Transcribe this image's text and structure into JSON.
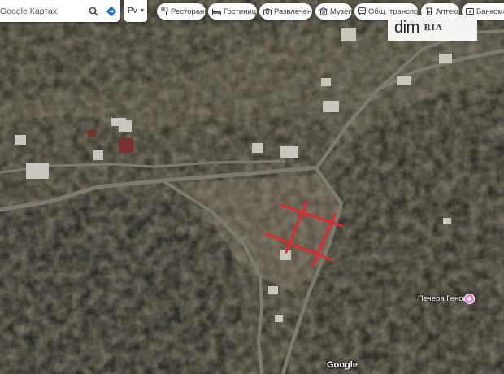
{
  "search": {
    "placeholder": "Google Картах"
  },
  "layer_select": {
    "label": "Рv"
  },
  "chips": [
    {
      "label": "Рестораны",
      "icon": "restaurant-icon"
    },
    {
      "label": "Гостиницы",
      "icon": "hotel-icon"
    },
    {
      "label": "Развлечения",
      "icon": "camera-icon"
    },
    {
      "label": "Музеи",
      "icon": "museum-icon"
    },
    {
      "label": "Общ. транспорт",
      "icon": "transit-icon"
    },
    {
      "label": "Аптеки",
      "icon": "pharmacy-icon"
    },
    {
      "label": "Банкоматы",
      "icon": "atm-icon"
    }
  ],
  "watermark": {
    "brand": "dim",
    "brand_suffix": "RIA"
  },
  "poi": {
    "label": "Печера Геноват",
    "icon": "poi-pin-icon",
    "color": "#e37bd0"
  },
  "attribution": "Google",
  "marker": {
    "color": "#e8262d"
  }
}
